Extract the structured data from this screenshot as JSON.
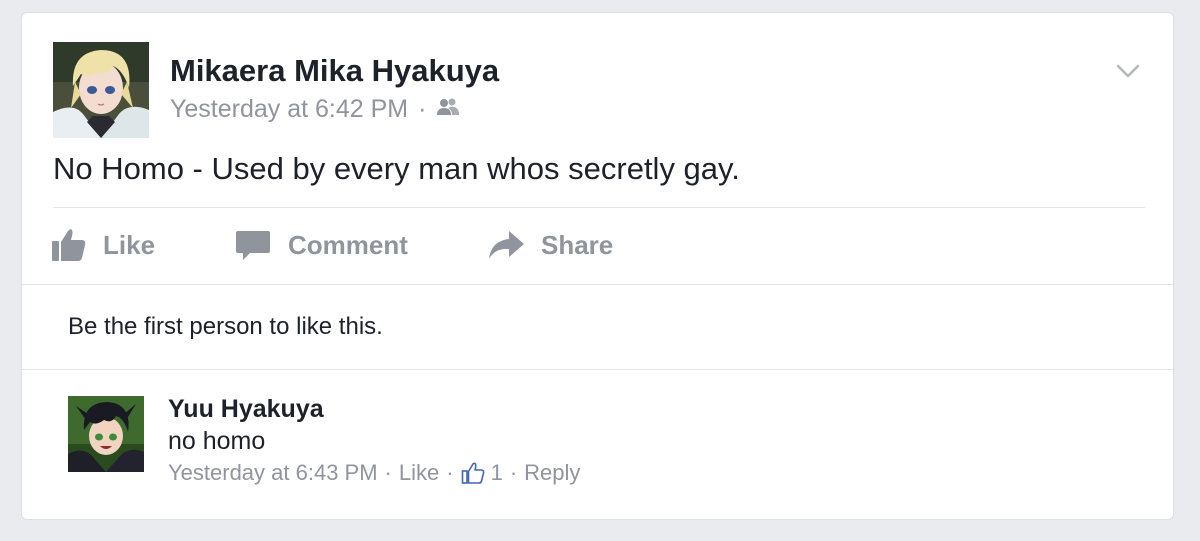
{
  "post": {
    "author": "Mikaera Mika Hyakuya",
    "timestamp": "Yesterday at 6:42 PM",
    "separator": "·",
    "audience_icon": "friends-icon",
    "text": "No Homo - Used by every man whos secretly gay.",
    "menu_icon": "chevron-down-icon"
  },
  "actions": {
    "like": "Like",
    "comment": "Comment",
    "share": "Share"
  },
  "likes_summary": "Be the first person to like this.",
  "comment": {
    "author": "Yuu Hyakuya",
    "text": "no homo",
    "timestamp": "Yesterday at 6:43 PM",
    "sep": "·",
    "like_label": "Like",
    "like_count": "1",
    "reply_label": "Reply"
  },
  "colors": {
    "background": "#e9ebee",
    "card": "#ffffff",
    "text": "#1d2129",
    "muted": "#90949c"
  }
}
